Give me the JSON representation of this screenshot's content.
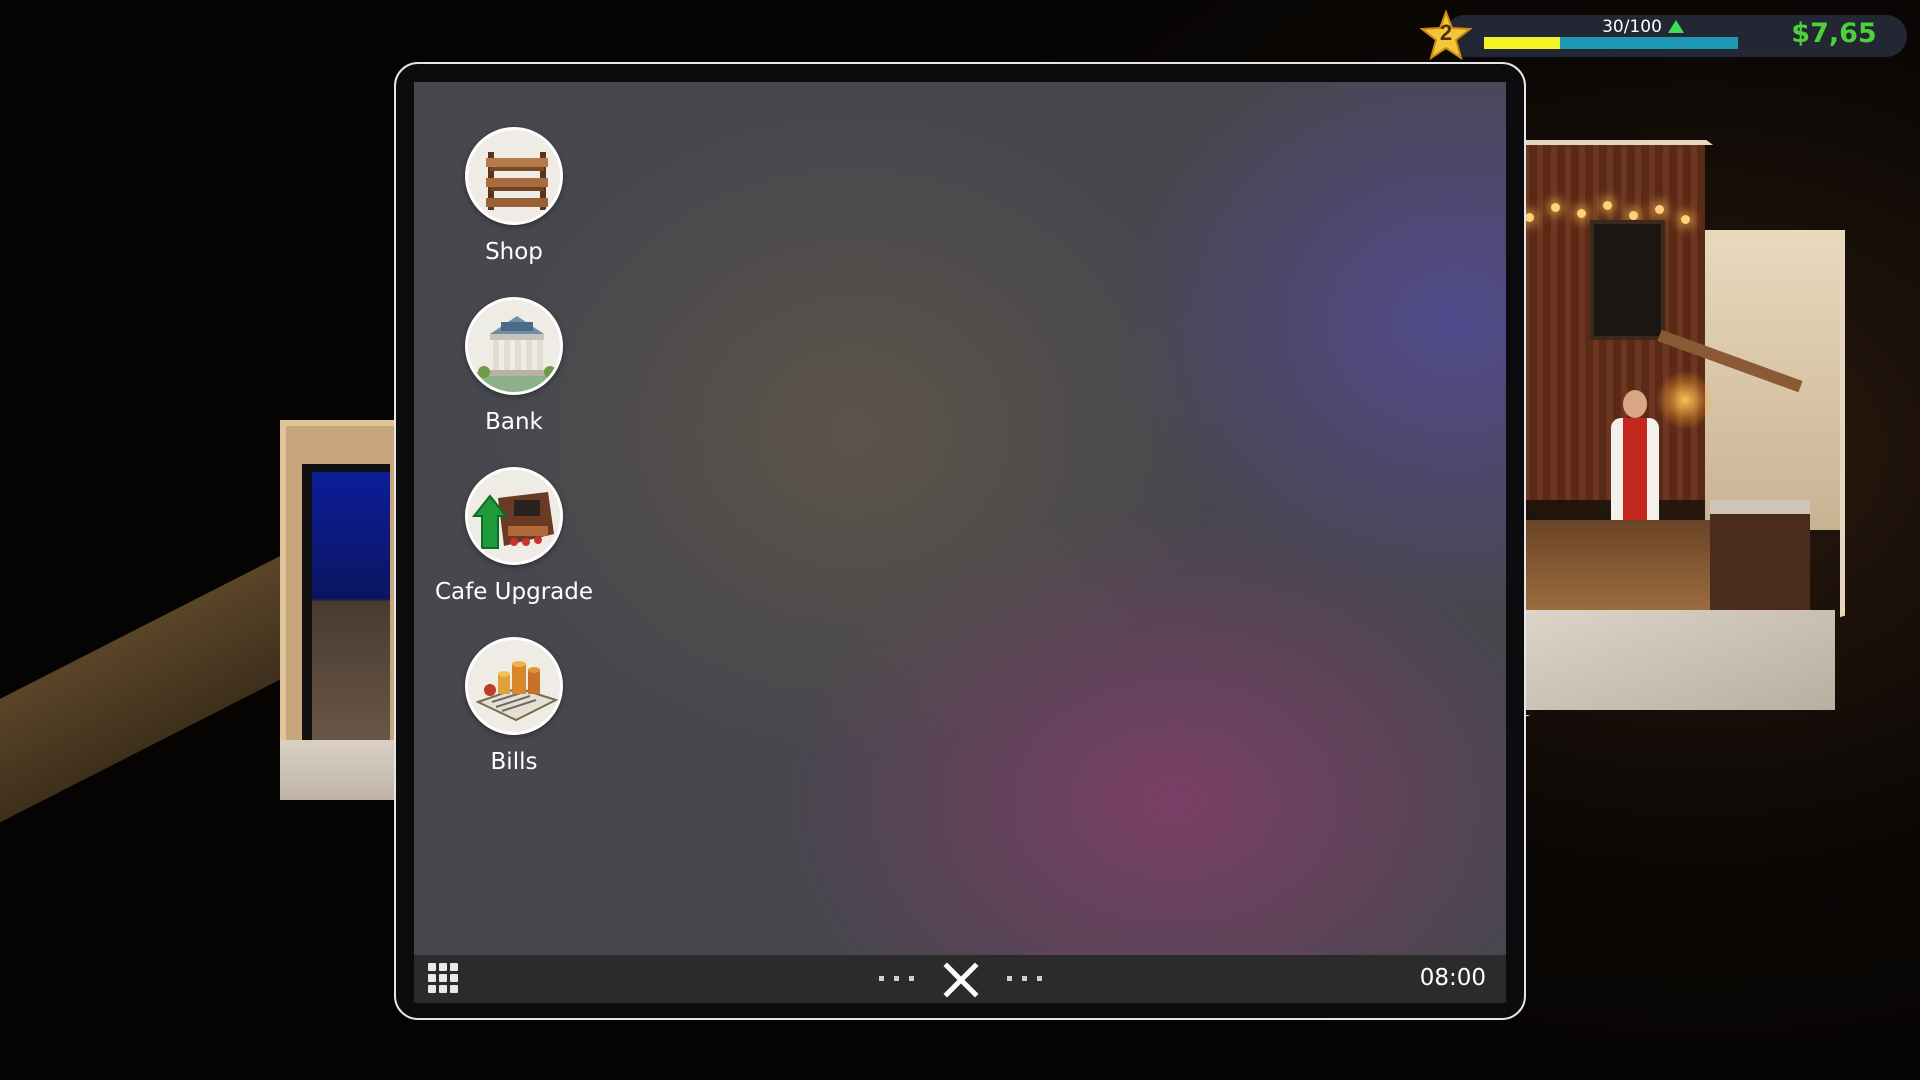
{
  "hud": {
    "level": "2",
    "xp_text": "30/100",
    "xp_current": 30,
    "xp_max": 100,
    "money": "$7,65",
    "colors": {
      "xp_fill": "#f4f32a",
      "xp_track": "#1d99b5",
      "money": "#4dd13a",
      "xp_up_arrow": "#3fdc57"
    }
  },
  "phone": {
    "apps": [
      {
        "label": "Shop",
        "icon": "shop-shelf-icon"
      },
      {
        "label": "Bank",
        "icon": "bank-building-icon"
      },
      {
        "label": "Cafe Upgrade",
        "icon": "cafe-upgrade-icon"
      },
      {
        "label": "Bills",
        "icon": "bills-coins-icon"
      }
    ],
    "taskbar": {
      "menu_icon": "app-grid-icon",
      "close_icon": "close-icon",
      "clock": "08:00"
    }
  }
}
